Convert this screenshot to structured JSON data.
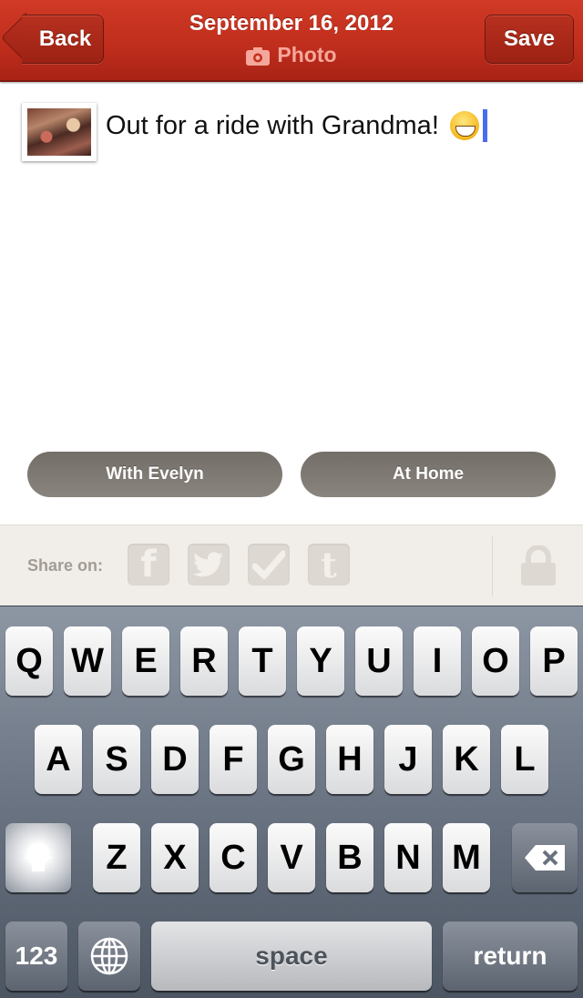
{
  "navbar": {
    "back_label": "Back",
    "save_label": "Save",
    "title": "September 16, 2012",
    "subtitle": "Photo",
    "subtitle_icon": "camera-icon",
    "accent_color": "#c0301f"
  },
  "entry": {
    "thumbnail": "photo-thumbnail",
    "text": "Out for a ride with Grandma!",
    "emoji": "grinning-face-emoji"
  },
  "tags": {
    "with_label": "With Evelyn",
    "at_label": "At Home"
  },
  "share": {
    "label": "Share on:",
    "services": [
      {
        "name": "facebook",
        "glyph": "f"
      },
      {
        "name": "twitter",
        "glyph": "🐦"
      },
      {
        "name": "foursquare-checkin",
        "glyph": "✔"
      },
      {
        "name": "tumblr",
        "glyph": "t"
      }
    ],
    "privacy_icon": "lock-icon"
  },
  "keyboard": {
    "row1": [
      "Q",
      "W",
      "E",
      "R",
      "T",
      "Y",
      "U",
      "I",
      "O",
      "P"
    ],
    "row2": [
      "A",
      "S",
      "D",
      "F",
      "G",
      "H",
      "J",
      "K",
      "L"
    ],
    "row3": [
      "Z",
      "X",
      "C",
      "V",
      "B",
      "N",
      "M"
    ],
    "numbers_label": "123",
    "space_label": "space",
    "return_label": "return"
  }
}
